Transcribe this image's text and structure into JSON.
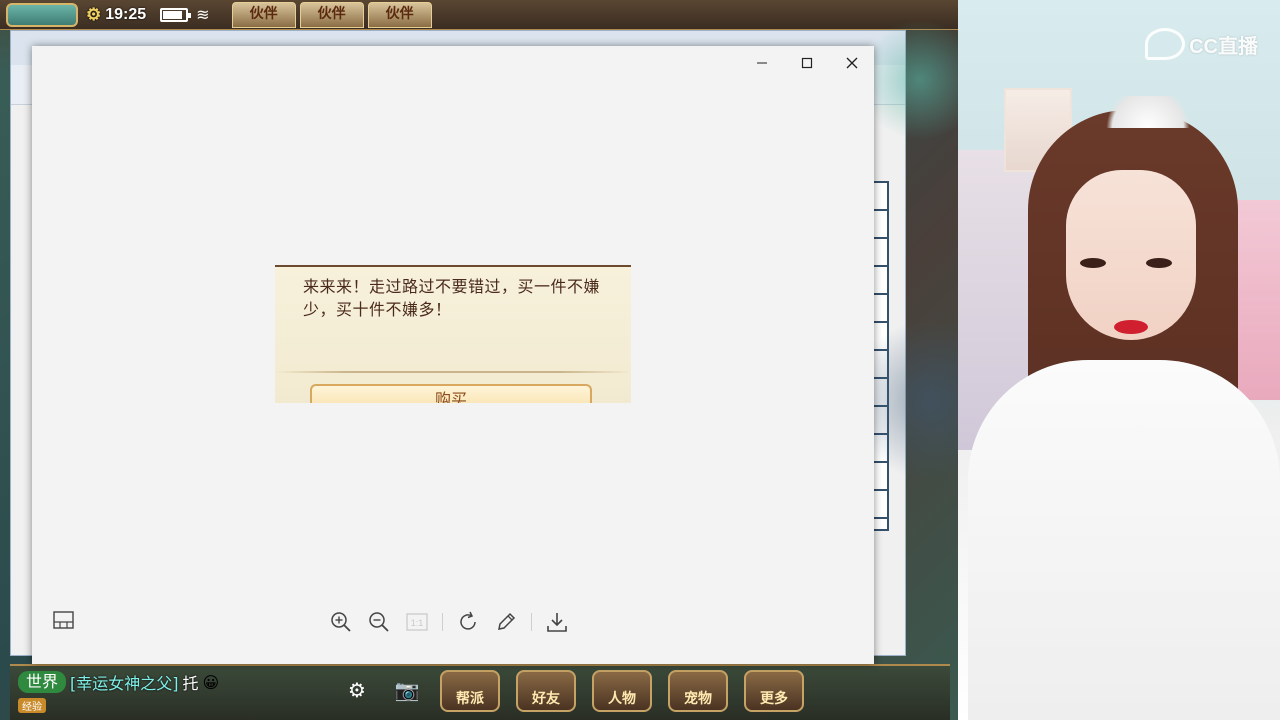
{
  "game": {
    "clock": "19:25",
    "battery_level": 0.85,
    "tabs": [
      "伙伴",
      "伙伴",
      "伙伴"
    ],
    "chat": {
      "channel": "世界",
      "user": "[幸运女神之父]",
      "message": "托",
      "xp_badge": "经验"
    },
    "bottom_buttons": [
      "帮派",
      "好友",
      "人物",
      "宠物",
      "更多"
    ]
  },
  "viewer": {
    "controls": {
      "minimize": "minimize",
      "maximize": "maximize",
      "close": "close"
    },
    "dialog": {
      "text": "来来来！走过路过不要错过，买一件不嫌少，买十件不嫌多！",
      "button_label": "购买",
      "colors": {
        "panel": "#f7f1dc",
        "text": "#4a2a1a",
        "button_text": "#8a4a18"
      }
    },
    "toolbar": {
      "left_icon": "panel-icon",
      "buttons": [
        "zoom-in-icon",
        "zoom-out-icon",
        "actual-size-icon",
        "rotate-icon",
        "edit-icon",
        "download-icon"
      ]
    }
  },
  "stream": {
    "logo_text": "CC直播",
    "accent": "#d0202f"
  }
}
